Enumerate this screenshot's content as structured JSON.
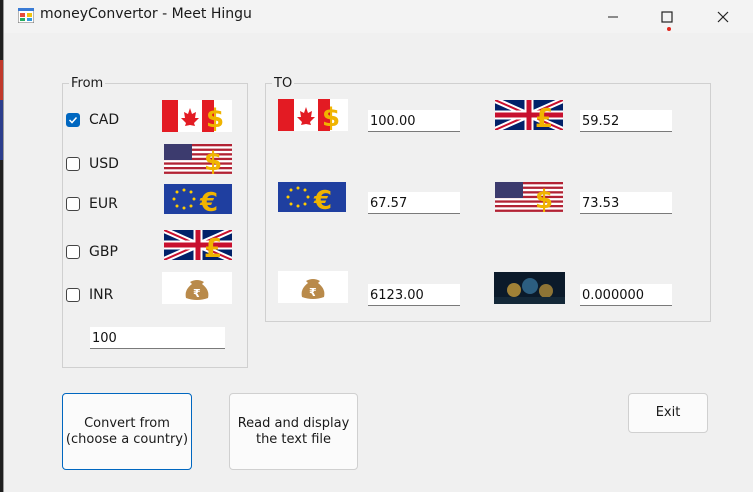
{
  "window": {
    "title": "moneyConvertor - Meet Hingu"
  },
  "from": {
    "legend": "From",
    "options": [
      {
        "label": "CAD",
        "checked": true
      },
      {
        "label": "USD",
        "checked": false
      },
      {
        "label": "EUR",
        "checked": false
      },
      {
        "label": "GBP",
        "checked": false
      },
      {
        "label": "INR",
        "checked": false
      }
    ],
    "amount": "100"
  },
  "to": {
    "legend": "TO",
    "cad_value": "100.00",
    "gbp_value": "59.52",
    "eur_value": "67.57",
    "usd_value": "73.53",
    "inr_value": "6123.00",
    "crypto_value": "0.000000"
  },
  "buttons": {
    "convert": "Convert from\n(choose a country)",
    "read": "Read and display\nthe text file",
    "exit": "Exit"
  }
}
